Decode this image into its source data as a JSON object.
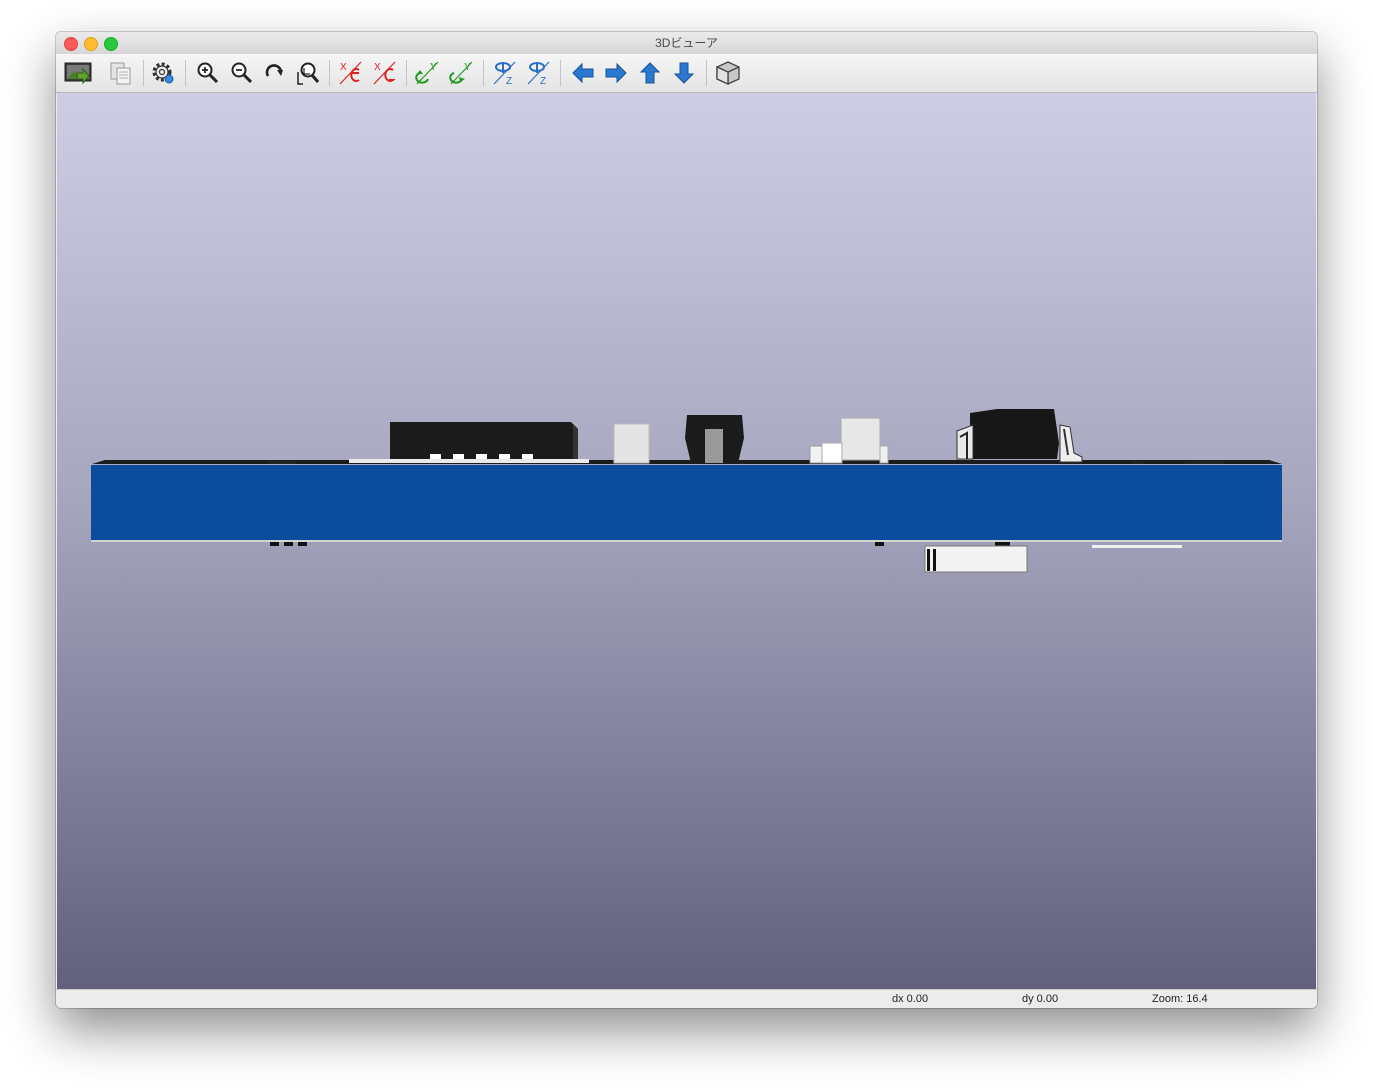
{
  "window": {
    "title": "3Dビューア"
  },
  "toolbar": {
    "buttons": [
      {
        "name": "render-image-button",
        "icon": "image-export-icon"
      },
      {
        "name": "copy-clipboard-button",
        "icon": "copy-icon"
      },
      {
        "name": "settings-button",
        "icon": "gear-icon"
      },
      {
        "name": "zoom-in-button",
        "icon": "zoom-in-icon"
      },
      {
        "name": "zoom-out-button",
        "icon": "zoom-out-icon"
      },
      {
        "name": "redraw-button",
        "icon": "redraw-icon"
      },
      {
        "name": "zoom-fit-button",
        "icon": "zoom-fit-icon"
      },
      {
        "name": "rotate-x-cw-button",
        "icon": "rotate-x-cw-icon"
      },
      {
        "name": "rotate-x-ccw-button",
        "icon": "rotate-x-ccw-icon"
      },
      {
        "name": "rotate-y-cw-button",
        "icon": "rotate-y-cw-icon"
      },
      {
        "name": "rotate-y-ccw-button",
        "icon": "rotate-y-ccw-icon"
      },
      {
        "name": "rotate-z-cw-button",
        "icon": "rotate-z-cw-icon"
      },
      {
        "name": "rotate-z-ccw-button",
        "icon": "rotate-z-ccw-icon"
      },
      {
        "name": "move-left-button",
        "icon": "arrow-left-icon"
      },
      {
        "name": "move-right-button",
        "icon": "arrow-right-icon"
      },
      {
        "name": "move-up-button",
        "icon": "arrow-up-icon"
      },
      {
        "name": "move-down-button",
        "icon": "arrow-down-icon"
      },
      {
        "name": "ortho-toggle-button",
        "icon": "cube-icon"
      }
    ],
    "labels": {
      "x": "X",
      "y": "Y",
      "z": "Z"
    }
  },
  "viewport": {
    "board_color": "#0b4c9c",
    "background_top": "#cdcde4",
    "background_bottom": "#62607c"
  },
  "status": {
    "dx": "dx 0.00",
    "dy": "dy 0.00",
    "zoom": "Zoom: 16.4"
  }
}
